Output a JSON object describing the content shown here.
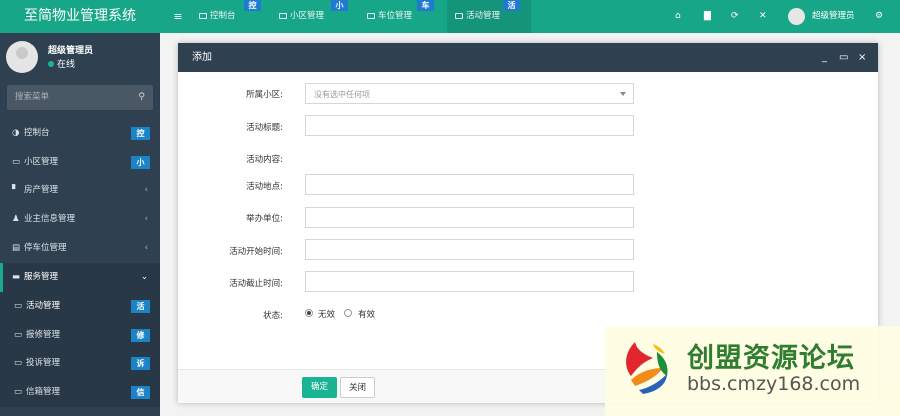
{
  "app": {
    "title": "至简物业管理系统"
  },
  "top_tabs": [
    {
      "label": "控制台",
      "badge": "控",
      "icon": "dashboard-icon"
    },
    {
      "label": "小区管理",
      "badge": "小",
      "icon": "list-icon"
    },
    {
      "label": "车位管理",
      "badge": "车",
      "icon": "list-icon"
    },
    {
      "label": "活动管理",
      "badge": "活",
      "icon": "list-icon"
    }
  ],
  "top_icons": [
    "home-icon",
    "trash-icon",
    "refresh-icon",
    "fullscreen-icon",
    "settings-icon"
  ],
  "user": {
    "name": "超级管理员",
    "status": "在线"
  },
  "sidebar": {
    "search_placeholder": "搜索菜单",
    "items": [
      {
        "label": "控制台",
        "badge": "控"
      },
      {
        "label": "小区管理",
        "badge": "小"
      },
      {
        "label": "房产管理",
        "chevron": "‹"
      },
      {
        "label": "业主信息管理",
        "chevron": "‹"
      },
      {
        "label": "停车位管理",
        "chevron": "‹"
      },
      {
        "label": "服务管理",
        "chevron": "⌄"
      },
      {
        "label": "活动管理",
        "badge": "活"
      },
      {
        "label": "报修管理",
        "badge": "修"
      },
      {
        "label": "投诉管理",
        "badge": "诉"
      },
      {
        "label": "信箱管理",
        "badge": "信"
      }
    ]
  },
  "modal": {
    "title": "添加",
    "fields": [
      {
        "label": "所属小区:",
        "type": "select",
        "value": "没有选中任何项"
      },
      {
        "label": "活动标题:",
        "type": "text",
        "value": ""
      },
      {
        "label": "活动内容:",
        "type": "label",
        "value": ""
      },
      {
        "label": "活动地点:",
        "type": "text",
        "value": ""
      },
      {
        "label": "举办单位:",
        "type": "text",
        "value": ""
      },
      {
        "label": "活动开始时间:",
        "type": "text",
        "value": ""
      },
      {
        "label": "活动截止时间:",
        "type": "text",
        "value": ""
      }
    ],
    "status": {
      "label": "状态:",
      "options": [
        "无效",
        "有效"
      ],
      "selected": "无效"
    },
    "buttons": {
      "ok": "确定",
      "close": "关闭"
    }
  },
  "watermark": {
    "title": "创盟资源论坛",
    "url": "bbs.cmzy168.com"
  }
}
